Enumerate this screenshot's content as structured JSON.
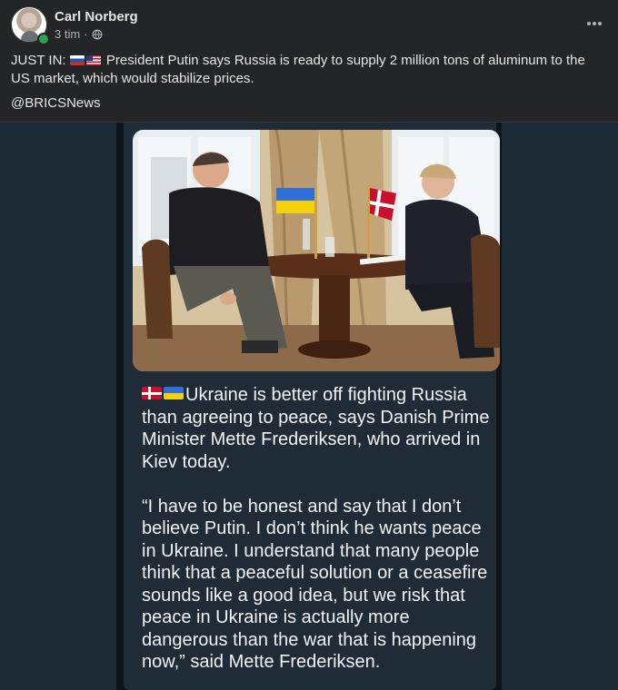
{
  "post": {
    "author": "Carl Norberg",
    "time": "3 tim",
    "separator": "·",
    "privacy_icon": "globe-icon",
    "more_icon": "more-dots-icon",
    "more_label": "···",
    "text_prefix": "JUST IN:",
    "flags": [
      "russia-flag",
      "usa-flag"
    ],
    "text_body": "President Putin says Russia is ready to supply 2 million tons of aluminum to the US market, which would stabilize prices.",
    "source": "@BRICSNews"
  },
  "attachment": {
    "photo": "image-photo",
    "caption_flags": [
      "denmark-flag",
      "ukraine-flag"
    ],
    "caption_paragraph1": "Ukraine is better off fighting Russia than agreeing to peace, says Danish Prime Minister Mette Frederiksen, who arrived in Kiev today.",
    "caption_paragraph2": "“I have to be honest and say that I don’t believe Putin. I don’t think he wants peace in Ukraine. I understand that many people think that a peaceful solution or a ceasefire sounds like a good idea, but we risk that peace in Ukraine is actually more dangerous than the war that is happening now,” said Mette Frederiksen."
  },
  "colors": {
    "background": "#242526",
    "text": "#e4e6eb",
    "secondary_text": "#b0b3b8",
    "online": "#31a24c",
    "attachment_bg": "#1c2a35"
  }
}
